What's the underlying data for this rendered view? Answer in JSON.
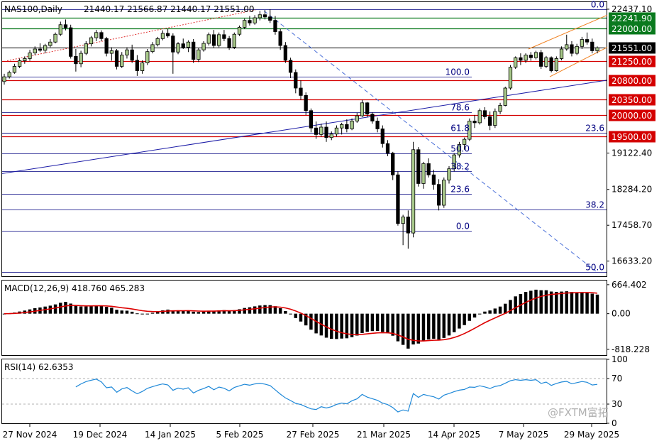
{
  "header": {
    "symbol": "NAS100,Daily",
    "ohlc": "21440.17 21566.87 21440.17 21551.00"
  },
  "chart_data": [
    {
      "type": "candlestick",
      "name": "price",
      "ylim": [
        16300,
        22600
      ],
      "y_ticks": [
        "22437.10",
        "19122.40",
        "18284.20",
        "17458.70",
        "16633.20"
      ],
      "x_ticks": [
        "27 Nov 2024",
        "19 Dec 2024",
        "14 Jan 2025",
        "5 Feb 2025",
        "27 Feb 2025",
        "21 Mar 2025",
        "14 Apr 2025",
        "7 May 2025",
        "29 May 2025"
      ],
      "levels": [
        {
          "label": "22241.90",
          "value": 22241.9,
          "color": "#0a7a1e"
        },
        {
          "label": "22000.00",
          "value": 22000,
          "color": "#0a7a1e"
        },
        {
          "label": "21551.00",
          "value": 21551,
          "color": "#000000"
        },
        {
          "label": "21250.00",
          "value": 21250,
          "color": "#d40000"
        },
        {
          "label": "20800.00",
          "value": 20800,
          "color": "#d40000"
        },
        {
          "label": "20350.00",
          "value": 20350,
          "color": "#d40000"
        },
        {
          "label": "20000.00",
          "value": 20000,
          "color": "#d40000"
        },
        {
          "label": "19500.00",
          "value": 19500,
          "color": "#d40000"
        }
      ],
      "fib_large": [
        {
          "label": "0.0",
          "value": 22437.1
        },
        {
          "label": "23.6",
          "value": 19582.8
        },
        {
          "label": "38.2",
          "value": 17816.2
        },
        {
          "label": "50.0",
          "value": 16389.0
        }
      ],
      "fib_small": [
        {
          "label": "100.0",
          "value": 20880
        },
        {
          "label": "78.6",
          "value": 20057
        },
        {
          "label": "61.8",
          "value": 19593
        },
        {
          "label": "50.0",
          "value": 19122
        },
        {
          "label": "38.2",
          "value": 18700
        },
        {
          "label": "23.6",
          "value": 18176
        },
        {
          "label": "0.0",
          "value": 17330
        }
      ],
      "candles": [
        [
          20770,
          20950,
          20700,
          20880
        ],
        [
          20880,
          21020,
          20840,
          20980
        ],
        [
          20980,
          21180,
          20950,
          21120
        ],
        [
          21120,
          21300,
          21080,
          21250
        ],
        [
          21250,
          21350,
          21180,
          21300
        ],
        [
          21300,
          21500,
          21250,
          21430
        ],
        [
          21430,
          21580,
          21380,
          21520
        ],
        [
          21520,
          21650,
          21450,
          21490
        ],
        [
          21490,
          21640,
          21420,
          21600
        ],
        [
          21600,
          21750,
          21560,
          21680
        ],
        [
          21680,
          21900,
          21650,
          21860
        ],
        [
          21860,
          22150,
          21820,
          22080
        ],
        [
          22080,
          22200,
          21950,
          22010
        ],
        [
          22010,
          22080,
          21300,
          21350
        ],
        [
          21350,
          21520,
          21000,
          21180
        ],
        [
          21180,
          21480,
          21100,
          21420
        ],
        [
          21420,
          21700,
          21380,
          21640
        ],
        [
          21640,
          21820,
          21580,
          21780
        ],
        [
          21780,
          21960,
          21700,
          21900
        ],
        [
          21900,
          21950,
          21700,
          21760
        ],
        [
          21760,
          21800,
          21350,
          21420
        ],
        [
          21420,
          21560,
          21250,
          21480
        ],
        [
          21480,
          21520,
          21050,
          21120
        ],
        [
          21120,
          21450,
          21080,
          21380
        ],
        [
          21380,
          21560,
          21300,
          21500
        ],
        [
          21500,
          21620,
          21200,
          21260
        ],
        [
          21260,
          21380,
          20900,
          21020
        ],
        [
          21020,
          21260,
          20950,
          21200
        ],
        [
          21200,
          21520,
          21150,
          21460
        ],
        [
          21460,
          21680,
          21420,
          21620
        ],
        [
          21620,
          21800,
          21580,
          21760
        ],
        [
          21760,
          21950,
          21720,
          21880
        ],
        [
          21880,
          21980,
          21780,
          21820
        ],
        [
          21820,
          21880,
          20950,
          21450
        ],
        [
          21450,
          21680,
          21400,
          21640
        ],
        [
          21640,
          21760,
          21520,
          21560
        ],
        [
          21560,
          21720,
          21450,
          21680
        ],
        [
          21680,
          21750,
          21200,
          21280
        ],
        [
          21280,
          21550,
          21220,
          21500
        ],
        [
          21500,
          21700,
          21460,
          21650
        ],
        [
          21650,
          21900,
          21600,
          21850
        ],
        [
          21850,
          21960,
          21540,
          21600
        ],
        [
          21600,
          21900,
          21560,
          21850
        ],
        [
          21850,
          21960,
          21700,
          21760
        ],
        [
          21760,
          21820,
          21500,
          21560
        ],
        [
          21560,
          21900,
          21520,
          21860
        ],
        [
          21860,
          22060,
          21820,
          22020
        ],
        [
          22020,
          22220,
          21980,
          22180
        ],
        [
          22180,
          22280,
          22060,
          22120
        ],
        [
          22120,
          22300,
          22080,
          22240
        ],
        [
          22240,
          22400,
          22180,
          22310
        ],
        [
          22310,
          22420,
          22200,
          22260
        ],
        [
          22260,
          22437,
          22120,
          22180
        ],
        [
          22180,
          22280,
          21850,
          21920
        ],
        [
          21920,
          21980,
          21500,
          21600
        ],
        [
          21600,
          21680,
          21200,
          21260
        ],
        [
          21260,
          21320,
          20850,
          20980
        ],
        [
          20980,
          21050,
          20500,
          20620
        ],
        [
          20620,
          20800,
          20350,
          20450
        ],
        [
          20450,
          20520,
          20000,
          20100
        ],
        [
          20100,
          20150,
          19600,
          19700
        ],
        [
          19700,
          19850,
          19450,
          19550
        ],
        [
          19550,
          19800,
          19500,
          19720
        ],
        [
          19720,
          19850,
          19380,
          19480
        ],
        [
          19480,
          19620,
          19420,
          19560
        ],
        [
          19560,
          19760,
          19500,
          19700
        ],
        [
          19700,
          19820,
          19550,
          19780
        ],
        [
          19780,
          19900,
          19600,
          19680
        ],
        [
          19680,
          19920,
          19650,
          19860
        ],
        [
          19860,
          20050,
          19820,
          19980
        ],
        [
          19980,
          20350,
          19950,
          20280
        ],
        [
          20280,
          20300,
          19950,
          20020
        ],
        [
          20020,
          20060,
          19800,
          19860
        ],
        [
          19860,
          19940,
          19600,
          19680
        ],
        [
          19680,
          19760,
          19250,
          19340
        ],
        [
          19340,
          19420,
          19050,
          19120
        ],
        [
          19120,
          19150,
          18500,
          18620
        ],
        [
          18620,
          18700,
          17450,
          17500
        ],
        [
          17500,
          17700,
          17000,
          17650
        ],
        [
          17650,
          17800,
          16920,
          17280
        ],
        [
          17280,
          19380,
          17180,
          19200
        ],
        [
          19200,
          19260,
          18350,
          18420
        ],
        [
          18420,
          18920,
          18300,
          18880
        ],
        [
          18880,
          19000,
          18560,
          18620
        ],
        [
          18620,
          18740,
          18280,
          18400
        ],
        [
          18400,
          18520,
          17800,
          17920
        ],
        [
          17920,
          18560,
          17860,
          18500
        ],
        [
          18500,
          18820,
          18420,
          18760
        ],
        [
          18760,
          19120,
          18700,
          19080
        ],
        [
          19080,
          19380,
          19020,
          19320
        ],
        [
          19320,
          19480,
          19200,
          19440
        ],
        [
          19440,
          19920,
          19400,
          19860
        ],
        [
          19860,
          20000,
          19700,
          19820
        ],
        [
          19820,
          20150,
          19780,
          20100
        ],
        [
          20100,
          20180,
          19900,
          19960
        ],
        [
          19960,
          20080,
          19650,
          19760
        ],
        [
          19760,
          20150,
          19700,
          20080
        ],
        [
          20080,
          20280,
          20020,
          20220
        ],
        [
          20220,
          20650,
          20200,
          20620
        ],
        [
          20620,
          21150,
          20580,
          21100
        ],
        [
          21100,
          21350,
          21060,
          21320
        ],
        [
          21320,
          21420,
          21150,
          21260
        ],
        [
          21260,
          21420,
          21200,
          21380
        ],
        [
          21380,
          21450,
          21250,
          21320
        ],
        [
          21320,
          21480,
          21280,
          21440
        ],
        [
          21440,
          21500,
          21060,
          21120
        ],
        [
          21120,
          21360,
          21080,
          21320
        ],
        [
          21320,
          21350,
          20980,
          21020
        ],
        [
          21020,
          21350,
          21000,
          21300
        ],
        [
          21300,
          21580,
          21260,
          21520
        ],
        [
          21520,
          21850,
          21480,
          21620
        ],
        [
          21620,
          21700,
          21350,
          21420
        ],
        [
          21420,
          21640,
          21380,
          21580
        ],
        [
          21580,
          21800,
          21520,
          21740
        ],
        [
          21740,
          21900,
          21620,
          21680
        ],
        [
          21680,
          21760,
          21420,
          21480
        ],
        [
          21480,
          21580,
          21420,
          21551
        ]
      ]
    },
    {
      "type": "bar",
      "name": "MACD(12,26,9)",
      "label": "MACD(12,26,9) 418.760 465.283",
      "ylim": [
        -950,
        760
      ],
      "y_ticks": [
        "664.402",
        "0.00",
        "-818.228"
      ]
    },
    {
      "type": "line",
      "name": "RSI(14)",
      "label": "RSI(14) 62.6353",
      "ylim": [
        0,
        100
      ],
      "y_ticks": [
        "100",
        "70",
        "30",
        "0"
      ],
      "levels": [
        70,
        30
      ]
    }
  ],
  "colors": {
    "up_candle": "#a8c98a",
    "down_candle": "#000000",
    "support": "#d40000",
    "resistance_green": "#0a7a1e",
    "fib": "#000080",
    "trend_blue": "#1a1aa6",
    "macd_signal": "#dd0000",
    "rsi_line": "#1e88d8",
    "channel": "#f08020"
  },
  "watermark": "@FXTM富拓"
}
